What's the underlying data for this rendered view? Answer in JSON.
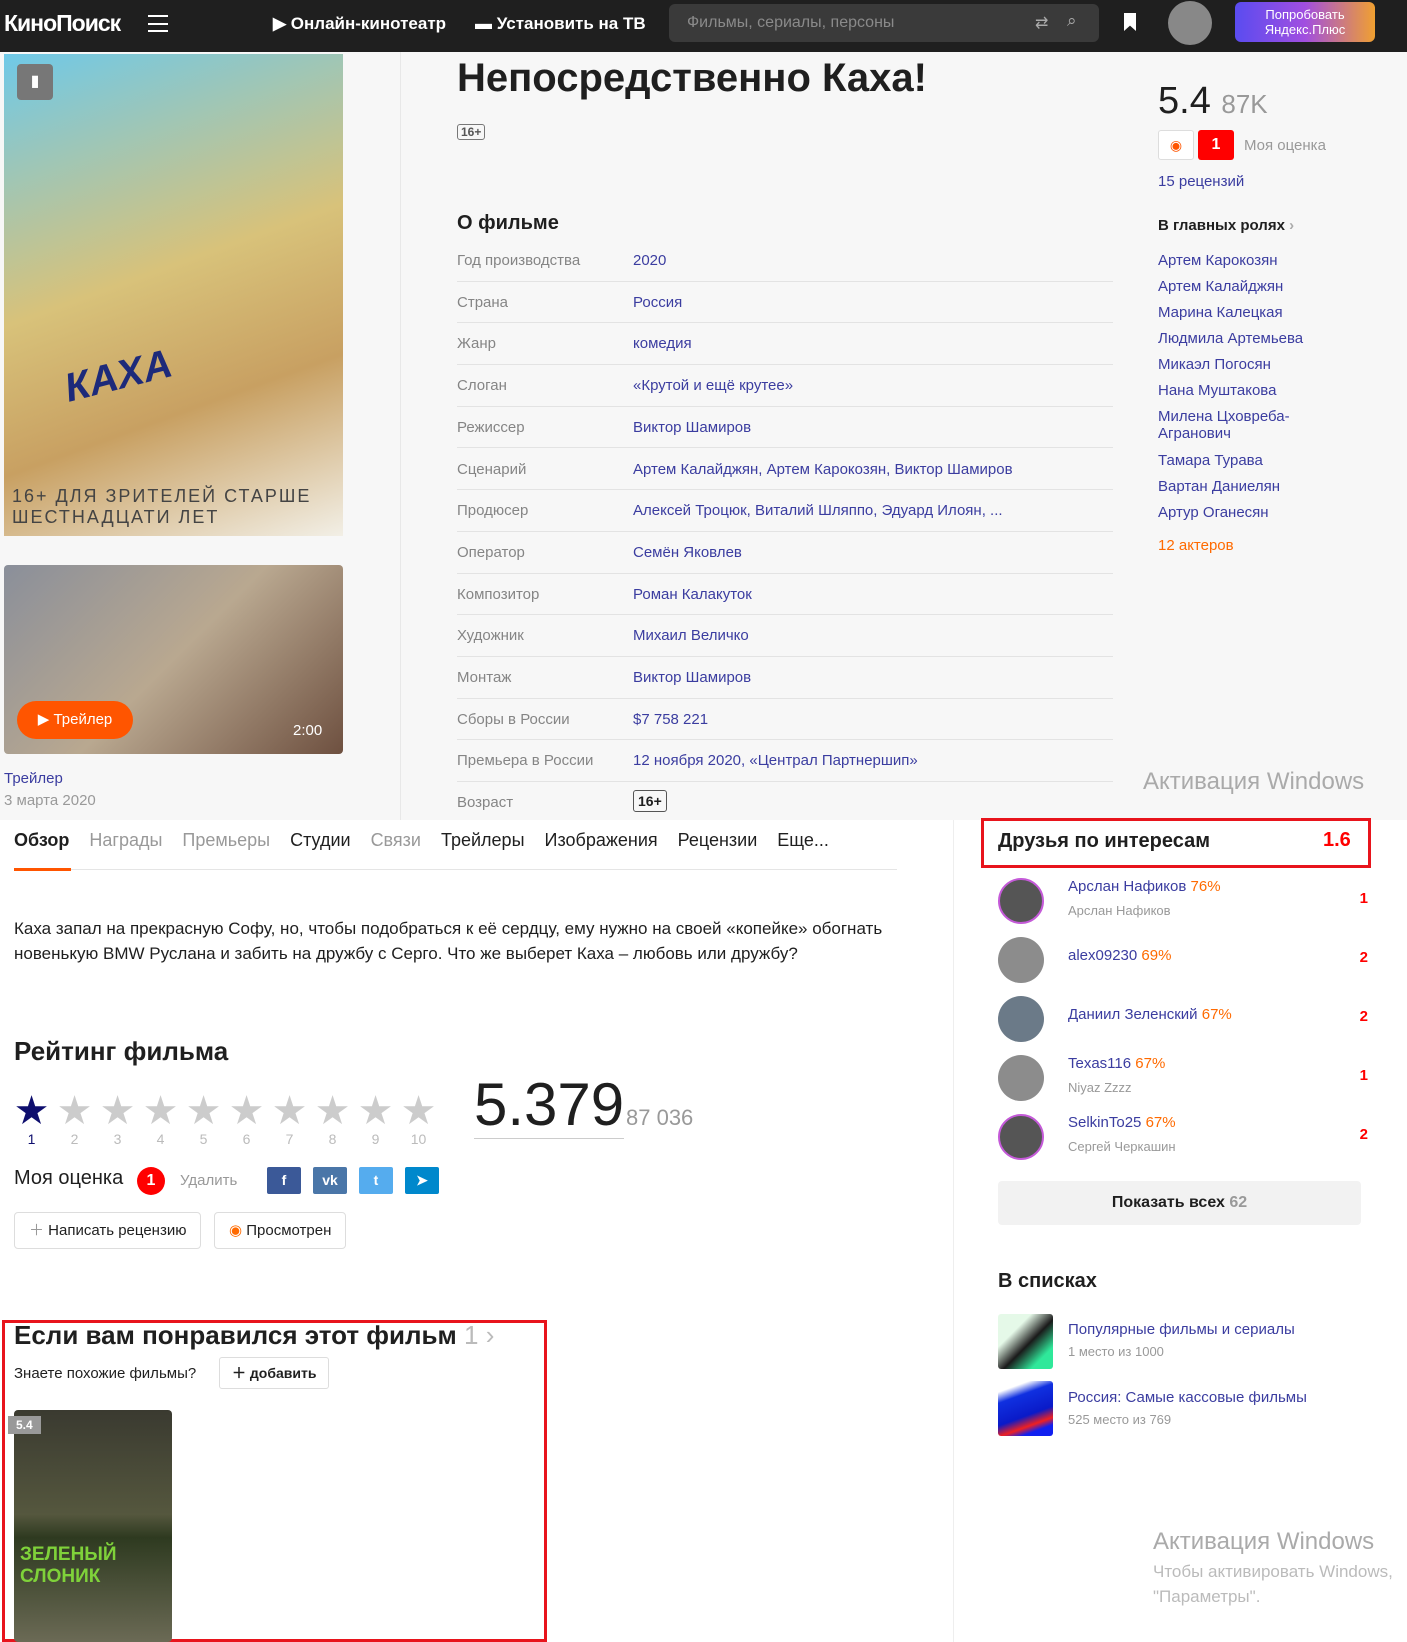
{
  "header": {
    "logo": "КиноПоиск",
    "online": "Онлайн-кинотеатр",
    "tv": "Установить на ТВ",
    "search_placeholder": "Фильмы, сериалы, персоны",
    "plus": "Попробовать Яндекс.Плюс"
  },
  "film": {
    "title": "Непосредственно Каха!",
    "age": "16+",
    "poster_text": "КАХА",
    "poster_bottom": "16+ ДЛЯ ЗРИТЕЛЕЙ СТАРШЕ ШЕСТНАДЦАТИ ЛЕТ"
  },
  "trailer": {
    "button": "Трейлер",
    "duration": "2:00",
    "title": "Трейлер",
    "date": "3 марта 2020"
  },
  "about": {
    "heading": "О фильме",
    "rows": [
      {
        "label": "Год производства",
        "value": "2020"
      },
      {
        "label": "Страна",
        "value": "Россия"
      },
      {
        "label": "Жанр",
        "value": "комедия"
      },
      {
        "label": "Слоган",
        "value": "«Крутой и ещё крутее»"
      },
      {
        "label": "Режиссер",
        "value": "Виктор Шамиров"
      },
      {
        "label": "Сценарий",
        "value": "Артем Калайджян, Артем Карокозян, Виктор Шамиров"
      },
      {
        "label": "Продюсер",
        "value": "Алексей Троцюк, Виталий Шляппо, Эдуард Илоян, ..."
      },
      {
        "label": "Оператор",
        "value": "Семён Яковлев"
      },
      {
        "label": "Композитор",
        "value": "Роман Калакуток"
      },
      {
        "label": "Художник",
        "value": "Михаил Величко"
      },
      {
        "label": "Монтаж",
        "value": "Виктор Шамиров"
      },
      {
        "label": "Сборы в России",
        "value": "$7 758 221"
      },
      {
        "label": "Премьера в России",
        "value": "12 ноября 2020, «Централ Партнершип»"
      },
      {
        "label": "Возраст",
        "value": "16+"
      }
    ]
  },
  "rating_side": {
    "value": "5.4",
    "votes": "87K",
    "my": "1",
    "my_label": "Моя оценка",
    "reviews": "15 рецензий"
  },
  "cast": {
    "heading": "В главных ролях",
    "actors": [
      "Артем Карокозян",
      "Артем Калайджян",
      "Марина Калецкая",
      "Людмила Артемьева",
      "Микаэл Погосян",
      "Нана Муштакова",
      "Милена Цховреба-Агранович",
      "Тамара Турава",
      "Вартан Даниелян",
      "Артур Оганесян"
    ],
    "more": "12 актеров"
  },
  "tabs": [
    "Обзор",
    "Награды",
    "Премьеры",
    "Студии",
    "Связи",
    "Трейлеры",
    "Изображения",
    "Рецензии",
    "Еще..."
  ],
  "description": "Каха запал на прекрасную Софу, но, чтобы подобраться к её сердцу, ему нужно на своей «копейке» обогнать новенькую BMW Руслана и забить на дружбу с Серго. Что же выберет Каха – любовь или дружбу?",
  "rating": {
    "heading": "Рейтинг фильма",
    "stars": [
      "1",
      "2",
      "3",
      "4",
      "5",
      "6",
      "7",
      "8",
      "9",
      "10"
    ],
    "selected": 1,
    "value": "5.379",
    "votes": "87 036",
    "my_label": "Моя оценка",
    "my": "1",
    "delete": "Удалить",
    "write_review": "Написать рецензию",
    "watched": "Просмотрен",
    "social": [
      "f",
      "vk",
      "tw",
      "tg"
    ]
  },
  "similar": {
    "heading": "Если вам понравился этот фильм",
    "count": "1",
    "question": "Знаете похожие фильмы?",
    "add": "добавить",
    "film_rating": "5.4",
    "film_poster_title": "ЗЕЛЕНЫЙ СЛОНИК"
  },
  "friends": {
    "heading": "Друзья по интересам",
    "score": "1.6",
    "items": [
      {
        "name": "Арслан Нафиков",
        "pct": "76%",
        "sub": "Арслан Нафиков",
        "rating": "1"
      },
      {
        "name": "alex09230",
        "pct": "69%",
        "sub": "",
        "rating": "2"
      },
      {
        "name": "Даниил Зеленский",
        "pct": "67%",
        "sub": "",
        "rating": "2"
      },
      {
        "name": "Texas116",
        "pct": "67%",
        "sub": "Niyaz Zzzz",
        "rating": "1"
      },
      {
        "name": "SelkinTo25",
        "pct": "67%",
        "sub": "Сергей Черкашин",
        "rating": "2"
      }
    ],
    "show_all": "Показать всех",
    "total": "62"
  },
  "lists": {
    "heading": "В списках",
    "items": [
      {
        "title": "Популярные фильмы и сериалы",
        "place": "1 место из 1000"
      },
      {
        "title": "Россия: Самые кассовые фильмы",
        "place": "525 место из 769"
      }
    ]
  },
  "watermark": {
    "title": "Активация Windows",
    "line1": "Чтобы активировать Windows,",
    "line2": "\"Параметры\"."
  }
}
